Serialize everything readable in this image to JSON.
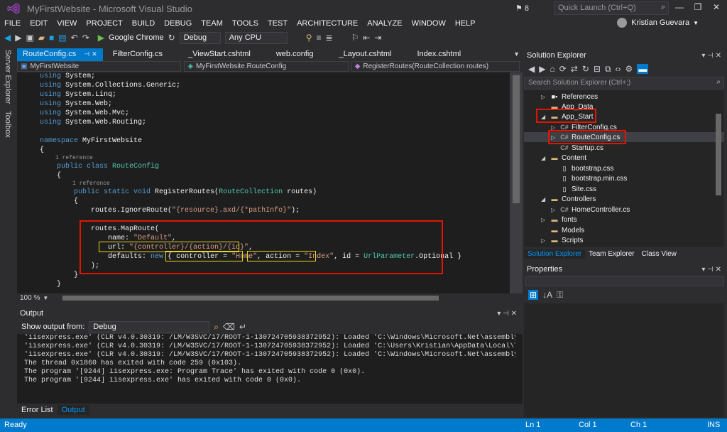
{
  "window": {
    "title": "MyFirstWebsite - Microsoft Visual Studio",
    "notifications": "8",
    "quick_launch_placeholder": "Quick Launch (Ctrl+Q)",
    "user": "Kristian Guevara"
  },
  "menu": [
    "FILE",
    "EDIT",
    "VIEW",
    "PROJECT",
    "BUILD",
    "DEBUG",
    "TEAM",
    "TOOLS",
    "TEST",
    "ARCHITECTURE",
    "ANALYZE",
    "WINDOW",
    "HELP"
  ],
  "toolbar": {
    "browser": "Google Chrome",
    "config": "Debug",
    "platform": "Any CPU"
  },
  "left_strip": [
    "Server Explorer",
    "Toolbox"
  ],
  "doc_tabs": [
    "RouteConfig.cs",
    "FilterConfig.cs",
    "_ViewStart.cshtml",
    "web.config",
    "_Layout.cshtml",
    "Index.cshtml"
  ],
  "navbar": {
    "project": "MyFirstWebsite",
    "class": "MyFirstWebsite.RouteConfig",
    "member": "RegisterRoutes(RouteCollection routes)"
  },
  "code": {
    "using1": "System;",
    "using2": "System.Collections.Generic;",
    "using3": "System.Linq;",
    "using4": "System.Web;",
    "using5": "System.Web.Mvc;",
    "using6": "System.Web.Routing;",
    "ns_name": "MyFirstWebsite",
    "ref1": "1 reference",
    "class_name": "RouteConfig",
    "ref2": "1 reference",
    "method_sig": "RegisterRoutes(",
    "param_type": "RouteCollection",
    "param_rest": " routes)",
    "ignore": "routes.IgnoreRoute(",
    "ignore_str": "\"{resource}.axd/{*pathInfo}\"",
    "ignore_end": ");",
    "maproute": "routes.MapRoute(",
    "name_lbl": "name: ",
    "name_val": "\"Default\"",
    "url_lbl": "url: ",
    "url_val": "\"{controller}/{action}/{id}\"",
    "def_lbl": "defaults: ",
    "ctrl_lbl": "controller = ",
    "ctrl_val": "\"Home\"",
    "act_lbl": "action = ",
    "act_val": "\"Index\"",
    "id_part": ", id = ",
    "urlparam": "UrlParameter",
    "optional": ".Optional }",
    "close_paren": ");"
  },
  "zoom": "100 %",
  "output": {
    "title": "Output",
    "show_from_label": "Show output from:",
    "show_from_value": "Debug",
    "lines": [
      "'iisexpress.exe' (CLR v4.0.30319: /LM/W3SVC/17/ROOT-1-130724705938372952): Loaded 'C:\\Windows\\Microsoft.Net\\assembly\\GAC_MSIL",
      "'iisexpress.exe' (CLR v4.0.30319: /LM/W3SVC/17/ROOT-1-130724705938372952): Loaded 'C:\\Users\\Kristian\\AppData\\Local\\Temp\\Tem",
      "'iisexpress.exe' (CLR v4.0.30319: /LM/W3SVC/17/ROOT-1-130724705938372952): Loaded 'C:\\Windows\\Microsoft.Net\\assembly\\GAC_MSIL",
      "The thread 0x1860 has exited with code 259 (0x103).",
      "The program '[9244] iisexpress.exe: Program Trace' has exited with code 0 (0x0).",
      "The program '[9244] iisexpress.exe' has exited with code 0 (0x0)."
    ],
    "tabs": [
      "Error List",
      "Output"
    ]
  },
  "solution_explorer": {
    "title": "Solution Explorer",
    "search_placeholder": "Search Solution Explorer (Ctrl+;)",
    "items": [
      "References",
      "App_Data",
      "App_Start",
      "FilterConfig.cs",
      "RouteConfig.cs",
      "Startup.cs",
      "Content",
      "bootstrap.css",
      "bootstrap.min.css",
      "Site.css",
      "Controllers",
      "HomeController.cs",
      "fonts",
      "Models",
      "Scripts"
    ],
    "tabs": [
      "Solution Explorer",
      "Team Explorer",
      "Class View"
    ]
  },
  "properties": {
    "title": "Properties"
  },
  "status": {
    "ready": "Ready",
    "ln": "Ln 1",
    "col": "Col 1",
    "ch": "Ch 1",
    "ins": "INS"
  },
  "colors": {
    "accent": "#007acc",
    "highlight_red": "#e51400",
    "highlight_yellow": "#e8d51e",
    "keyword": "#569cd6",
    "type": "#4ec9b0",
    "string": "#d69d85"
  }
}
